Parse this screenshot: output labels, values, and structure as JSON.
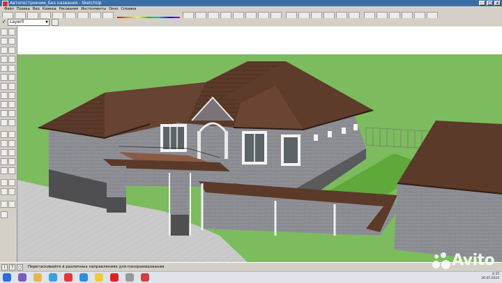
{
  "window": {
    "title": "Автопостроение_Без названия - SketchUp",
    "buttons": {
      "minimize": "_",
      "maximize": "□",
      "close": "x"
    }
  },
  "menu": {
    "items": [
      "Файл",
      "Правка",
      "Вид",
      "Камера",
      "Рисование",
      "Инструменты",
      "Окно",
      "Справка"
    ]
  },
  "layers": {
    "current_layer": "Layer0",
    "visible_check": "✓"
  },
  "status": {
    "hint": "Перетаскивайте в различных направлениях для панорамирования",
    "icons": [
      "i",
      "?",
      "○"
    ]
  },
  "taskbar": {
    "time": "4:35",
    "date": "26.05.2024"
  },
  "watermark": {
    "text": "Avito"
  },
  "colors": {
    "roof": "#5b3a2a",
    "roof_dark": "#4a2c1f",
    "wall_brick": "#8d8e94",
    "wall_base": "#4f4f52",
    "lawn": "#5fa83a",
    "field": "#7dbb5f",
    "paving": "#c8c8c8",
    "sky": "#ffffff",
    "title_bar": "#3a6ea5"
  }
}
